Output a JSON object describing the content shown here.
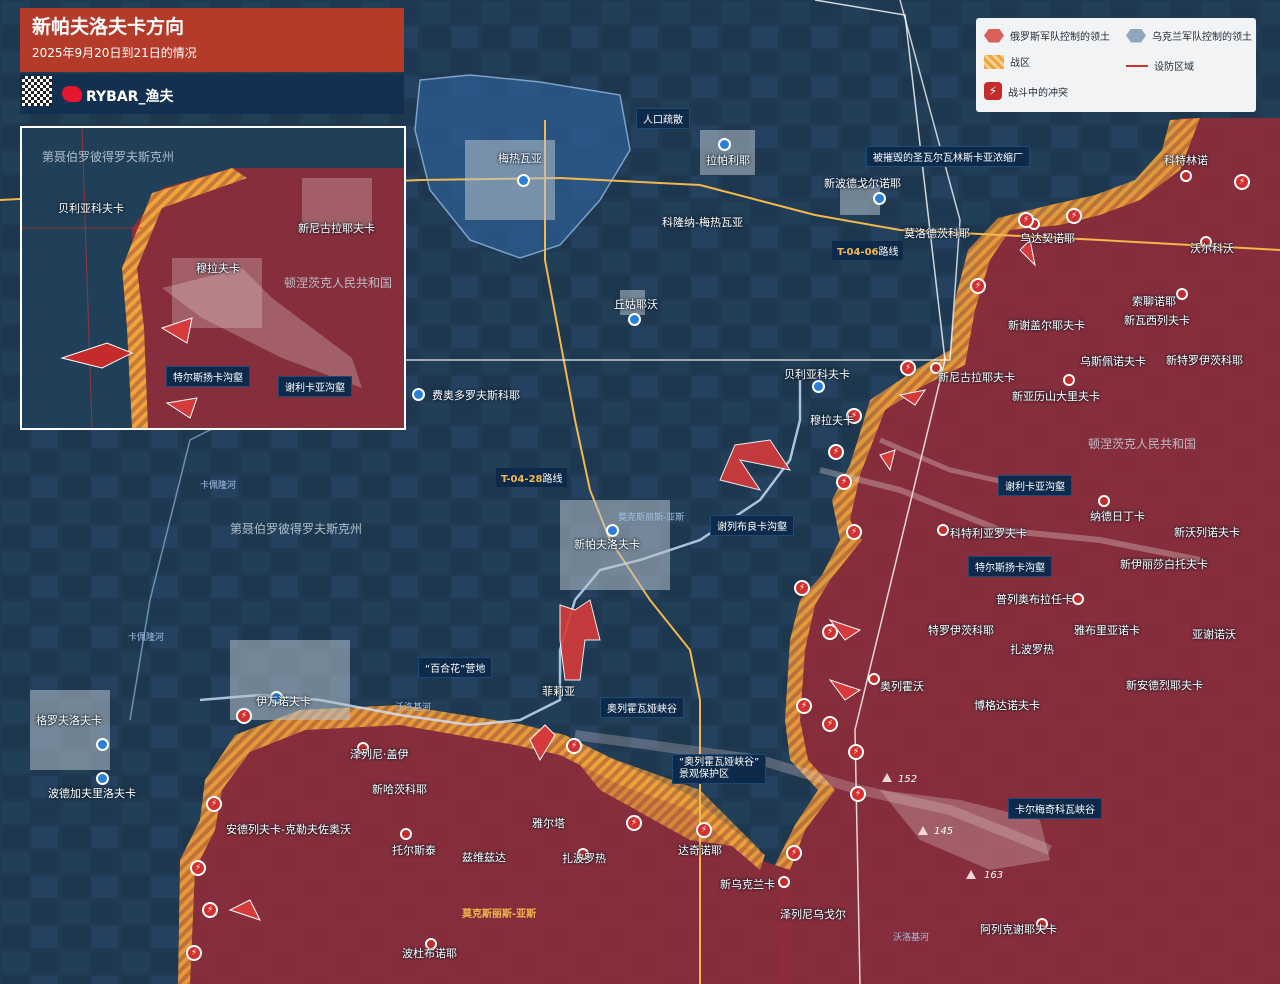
{
  "title": {
    "main": "新帕夫洛夫卡方向",
    "subtitle": "2025年9月20日到21日的情况",
    "brand": "RYBAR_渔夫"
  },
  "legend": {
    "ru_control": "俄罗斯军队控制的领土",
    "ua_control": "乌克兰军队控制的领土",
    "war_zone": "战区",
    "defense_line": "设防区域",
    "fighting": "战斗中的冲突"
  },
  "colors": {
    "russian_territory": "#8f2d3a",
    "ukrainian_area": "#2d5d92",
    "war_zone": "#f2a43a",
    "road": "#f2b84b",
    "river": "#8fb3e0"
  },
  "callouts": {
    "evacuation": "人口疏散",
    "destroyed_plant": "被摧毁的圣瓦尔瓦林斯卡亚浓缩厂",
    "trench_serikaya": "谢利卡亚沟壑",
    "trench_terskaya": "特尔斯扬卡沟壑",
    "trench_sereboloka": "谢列布良卡沟壑",
    "camp": "“百合花”营地",
    "ravine": "奥列霍瓦娅峡谷",
    "reserve": "“奥列霍瓦娅峡谷”\n景观保护区",
    "karlomegichi": "卡尔梅奇科瓦峡谷",
    "inset_trench_terskaya": "特尔斯扬卡沟壑",
    "inset_trench_serikaya": "谢利卡亚沟壑"
  },
  "roads": {
    "t0406_code": "T-04-06",
    "t0406_suffix": "路线",
    "t0428_code": "T-04-28",
    "t0428_suffix": "路线",
    "highway": "莫克斯丽斯-亚斯",
    "highway2": "沃洛基河"
  },
  "rivers": {
    "r1": "卡佩隆河",
    "r2": "卡佩隆河",
    "r3": "沃洛基河",
    "r4": "莫克斯丽斯-亚斯",
    "r5": "沃洛基河"
  },
  "regions": {
    "dnipro_main": "第聂伯罗彼得罗夫斯克州",
    "donetsk_main": "顿涅茨克人民共和国",
    "dnipro_inset": "第聂伯罗彼得罗夫斯克州",
    "donetsk_inset": "顿涅茨克人民共和国"
  },
  "towns": {
    "mezhova": "梅热瓦亚",
    "lapavlivka": "拉帕利耶",
    "novopodgornoe": "新波德戈尔诺耶",
    "kolonna": "科隆纳-梅热瓦亚",
    "chuhuiv": "丘姑耶沃",
    "zaporozhie": "莫洛德茨科耶",
    "fedorovka": "费奥多罗夫斯科耶",
    "novopavlivka": "新帕夫洛夫卡",
    "filia": "菲莉亚",
    "ivanivka": "伊万诺夫卡",
    "gorodovka": "格罗夫洛夫卡",
    "podgadovka": "波德加夫里洛夫卡",
    "zaliznichne": "泽列尼·盖伊",
    "novoivanivka": "新哈茨科耶",
    "andrivka": "安德列夫卡-克勒夫佐奥沃",
    "tolstoe": "托尔斯泰",
    "zelenyi": "兹维兹达",
    "yalta": "雅尔塔",
    "zaporozhzhia": "扎波罗热",
    "dachnoe": "达奇诺耶",
    "novoukrainka": "新乌克兰卡",
    "zelenodolsk": "泽列尼乌戈尔",
    "alekseevka": "阿列克谢耶夫卡",
    "podgornoe": "波杜布诺耶",
    "udachnoe": "乌达契诺耶",
    "kotlino": "科特林诺",
    "sorochiv": "沃尔科沃",
    "sokolovo": "索聊诺耶",
    "novoserg": "新谢盖尔耶夫卡",
    "novovasylivka": "新瓦西列夫卡",
    "uspenivka": "乌斯佩诺夫卡",
    "novotroitske": "新特罗伊茨科耶",
    "novoaleksandrovka": "新亚历山大里夫卡",
    "novonikolayevka": "新尼古拉耶夫卡",
    "belyakovka": "贝利亚科夫卡",
    "muravka": "穆拉夫卡",
    "kotlyarevka": "科特利亚罗夫卡",
    "nadezhda": "纳德日丁卡",
    "novosergeevka": "新沃列诺夫卡",
    "novolelyzavetovka": "新伊丽莎白托夫卡",
    "proletarka": "普列奥布拉任卡",
    "troitske": "特罗伊茨科耶",
    "yantar": "雅布里亚诺卡",
    "zaporozh2": "扎波罗热",
    "alekseevka2": "亚谢诺沃",
    "orekhovo": "奥列霍沃",
    "bogatyr": "博格达诺夫卡",
    "novoandrievka": "新安德烈耶夫卡",
    "inset_belyakovka": "贝利亚科夫卡",
    "inset_muravka": "穆拉夫卡",
    "inset_novonik": "新尼古拉耶夫卡"
  },
  "elevations": {
    "e1": "152",
    "e2": "145",
    "e3": "163"
  }
}
